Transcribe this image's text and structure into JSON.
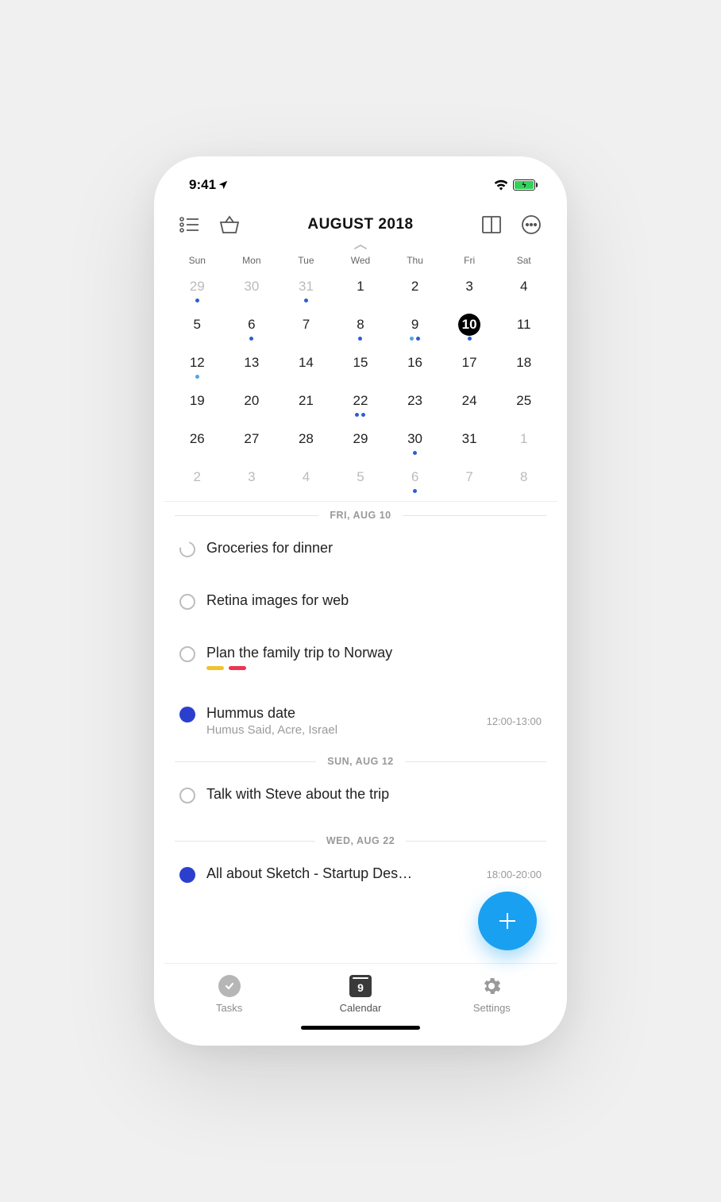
{
  "status": {
    "time": "9:41"
  },
  "header": {
    "title": "AUGUST 2018"
  },
  "dow": [
    "Sun",
    "Mon",
    "Tue",
    "Wed",
    "Thu",
    "Fri",
    "Sat"
  ],
  "grid": [
    [
      {
        "n": "29",
        "out": true,
        "dots": [
          "blue"
        ]
      },
      {
        "n": "30",
        "out": true
      },
      {
        "n": "31",
        "out": true,
        "dots": [
          "blue"
        ]
      },
      {
        "n": "1"
      },
      {
        "n": "2"
      },
      {
        "n": "3"
      },
      {
        "n": "4"
      }
    ],
    [
      {
        "n": "5"
      },
      {
        "n": "6",
        "dots": [
          "blue"
        ]
      },
      {
        "n": "7"
      },
      {
        "n": "8",
        "dots": [
          "blue"
        ]
      },
      {
        "n": "9",
        "dots": [
          "light",
          "blue"
        ]
      },
      {
        "n": "10",
        "sel": true,
        "dots": [
          "blue"
        ]
      },
      {
        "n": "11"
      }
    ],
    [
      {
        "n": "12",
        "dots": [
          "light"
        ]
      },
      {
        "n": "13"
      },
      {
        "n": "14"
      },
      {
        "n": "15"
      },
      {
        "n": "16"
      },
      {
        "n": "17"
      },
      {
        "n": "18"
      }
    ],
    [
      {
        "n": "19"
      },
      {
        "n": "20"
      },
      {
        "n": "21"
      },
      {
        "n": "22",
        "dots": [
          "blue",
          "blue"
        ]
      },
      {
        "n": "23"
      },
      {
        "n": "24"
      },
      {
        "n": "25"
      }
    ],
    [
      {
        "n": "26"
      },
      {
        "n": "27"
      },
      {
        "n": "28"
      },
      {
        "n": "29"
      },
      {
        "n": "30",
        "dots": [
          "blue"
        ]
      },
      {
        "n": "31"
      },
      {
        "n": "1",
        "out": true
      }
    ],
    [
      {
        "n": "2",
        "out": true
      },
      {
        "n": "3",
        "out": true
      },
      {
        "n": "4",
        "out": true
      },
      {
        "n": "5",
        "out": true
      },
      {
        "n": "6",
        "out": true,
        "dots": [
          "blue"
        ]
      },
      {
        "n": "7",
        "out": true
      },
      {
        "n": "8",
        "out": true
      }
    ]
  ],
  "agenda": [
    {
      "type": "header",
      "label": "FRI, AUG 10"
    },
    {
      "type": "task",
      "title": "Groceries for dinner",
      "circle": "open-gap"
    },
    {
      "type": "task",
      "title": "Retina images for web"
    },
    {
      "type": "task",
      "title": "Plan the family trip to Norway",
      "tags": [
        "#f3c22b",
        "#ef3351"
      ]
    },
    {
      "type": "event",
      "title": "Hummus date",
      "sub": "Humus Said, Acre, Israel",
      "time": "12:00-13:00"
    },
    {
      "type": "header",
      "label": "SUN, AUG 12"
    },
    {
      "type": "task",
      "title": "Talk with Steve about the trip"
    },
    {
      "type": "header",
      "label": "WED, AUG 22"
    },
    {
      "type": "event",
      "title": "All about Sketch - Startup Des…",
      "time": "18:00-20:00"
    }
  ],
  "tabs": {
    "tasks": "Tasks",
    "calendar": "Calendar",
    "calendar_day": "9",
    "settings": "Settings"
  }
}
